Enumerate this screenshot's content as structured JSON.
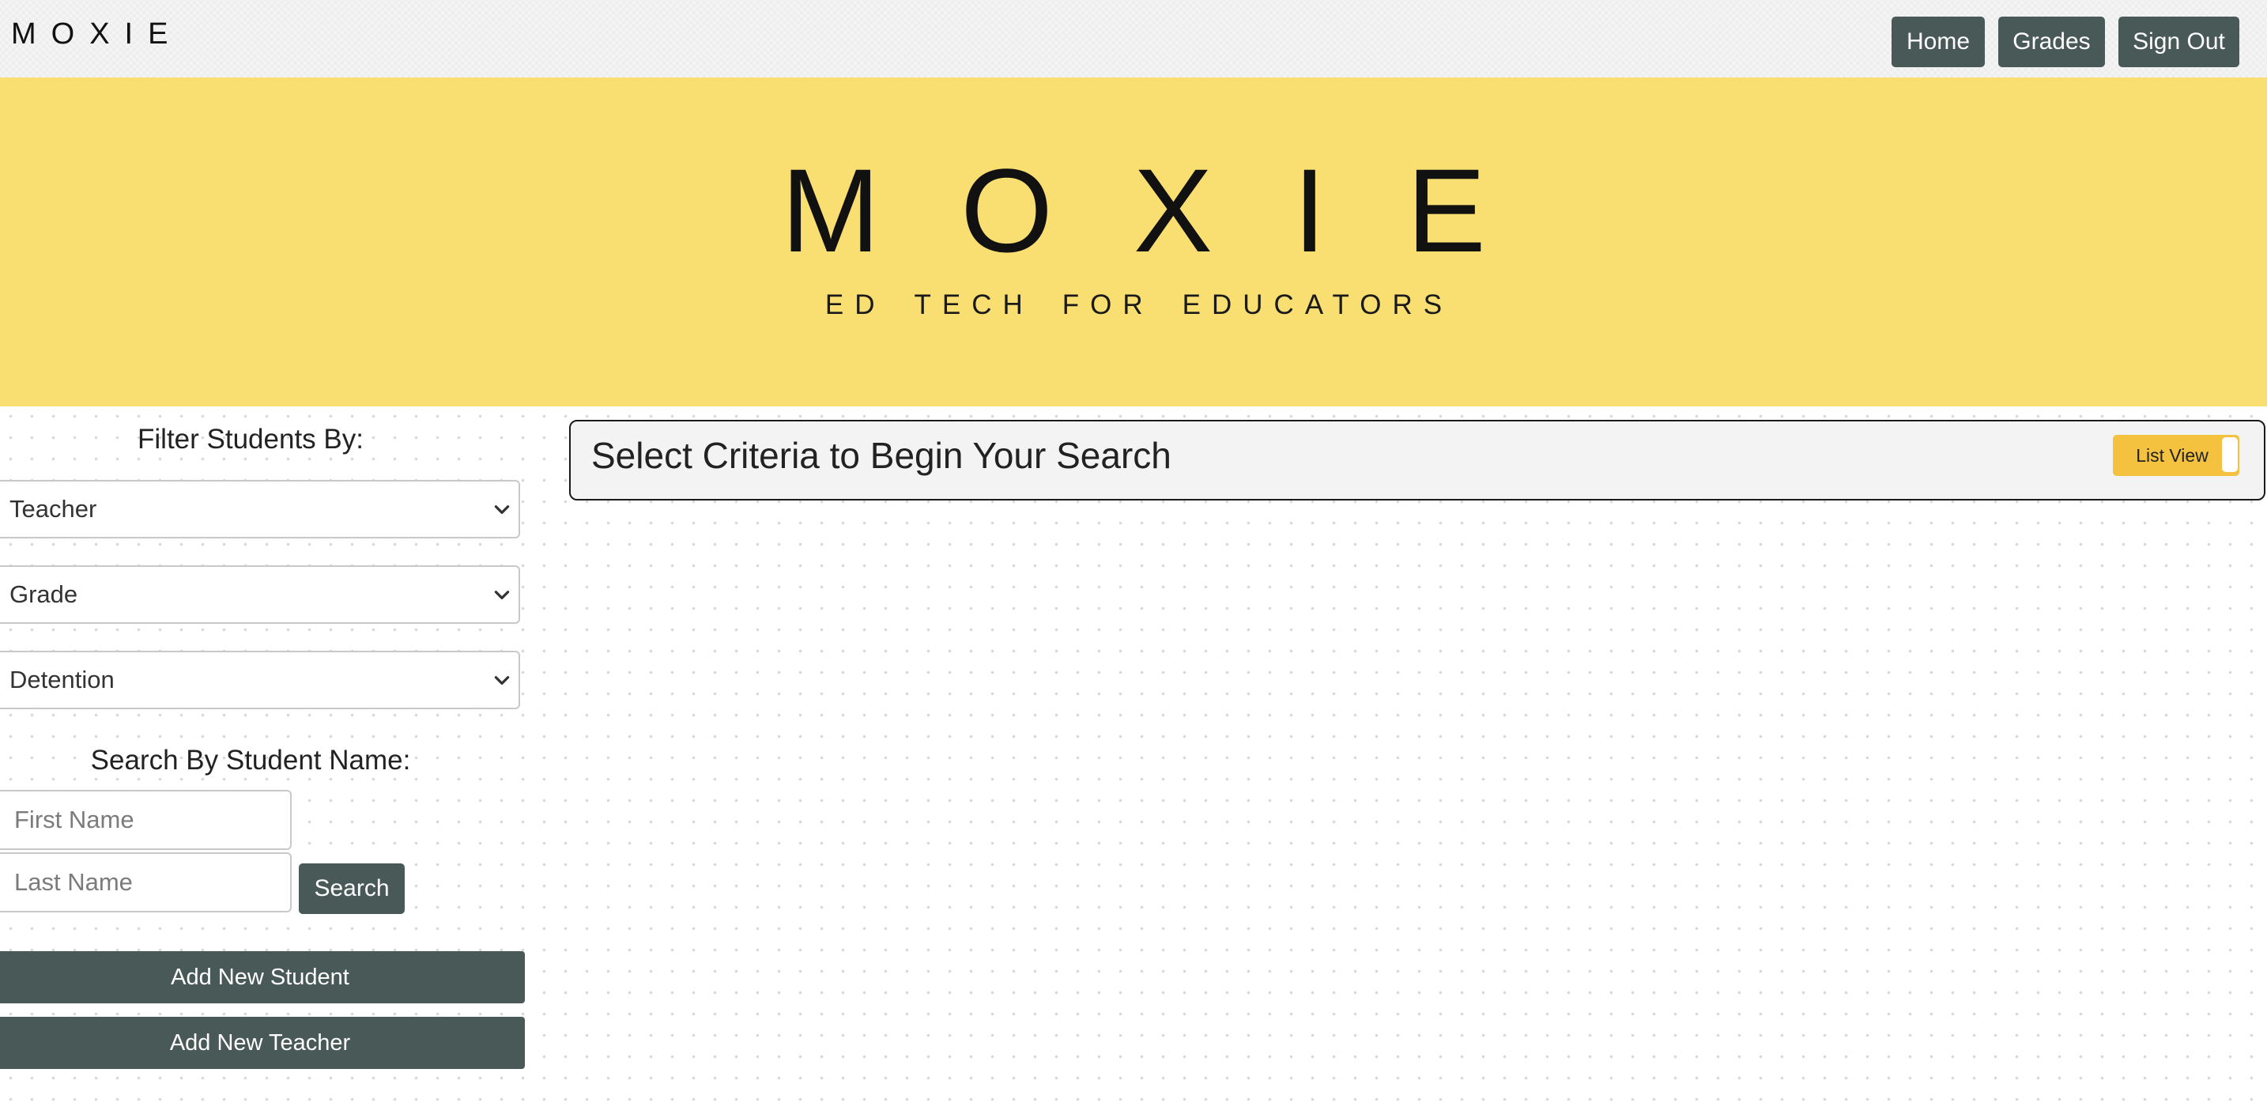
{
  "navbar": {
    "brand": "MOXIE",
    "links": {
      "home": "Home",
      "grades": "Grades",
      "sign_out": "Sign Out"
    }
  },
  "hero": {
    "title": "MOXIE",
    "subtitle_words": [
      "ED",
      "TECH",
      "FOR",
      "EDUCATORS"
    ],
    "background_color": "#f9de72"
  },
  "filters": {
    "heading": "Filter Students By:",
    "teacher_select": "Teacher",
    "grade_select": "Grade",
    "detention_select": "Detention"
  },
  "name_search": {
    "heading": "Search By Student Name:",
    "first_name_placeholder": "First Name",
    "last_name_placeholder": "Last Name",
    "search_label": "Search"
  },
  "actions": {
    "add_student": "Add New Student",
    "add_teacher": "Add New Teacher"
  },
  "results": {
    "prompt": "Select Criteria to Begin Your Search",
    "view_toggle_label": "List View",
    "toggle_color": "#f4c23f"
  },
  "theme": {
    "button_color": "#495957",
    "banner_color": "#f9de72"
  }
}
